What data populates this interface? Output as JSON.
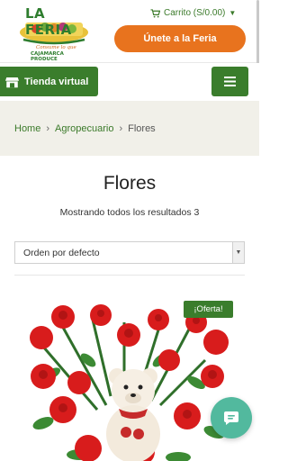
{
  "brand": {
    "name": "LA FERIA",
    "tagline": "Consume lo que",
    "tagline2": "CAJAMARCA PRODUCE"
  },
  "header": {
    "cart_label": "Carrito (S/0.00)",
    "join_label": "Únete a la Feria"
  },
  "nav": {
    "store_label": "Tienda virtual"
  },
  "breadcrumb": {
    "home": "Home",
    "category": "Agropecuario",
    "current": "Flores"
  },
  "main": {
    "title": "Flores",
    "result_count": "Mostrando todos los resultados 3",
    "sort_selected": "Orden por defecto"
  },
  "product": {
    "badge": "¡Oferta!"
  },
  "colors": {
    "brand_green": "#3a7d2c",
    "accent_orange": "#e8731e",
    "chat_teal": "#52b99e",
    "breadcrumb_bg": "#f1f0e9"
  },
  "icons": {
    "cart": "cart-icon",
    "store": "store-icon",
    "menu": "hamburger-icon",
    "chat": "chat-icon"
  }
}
